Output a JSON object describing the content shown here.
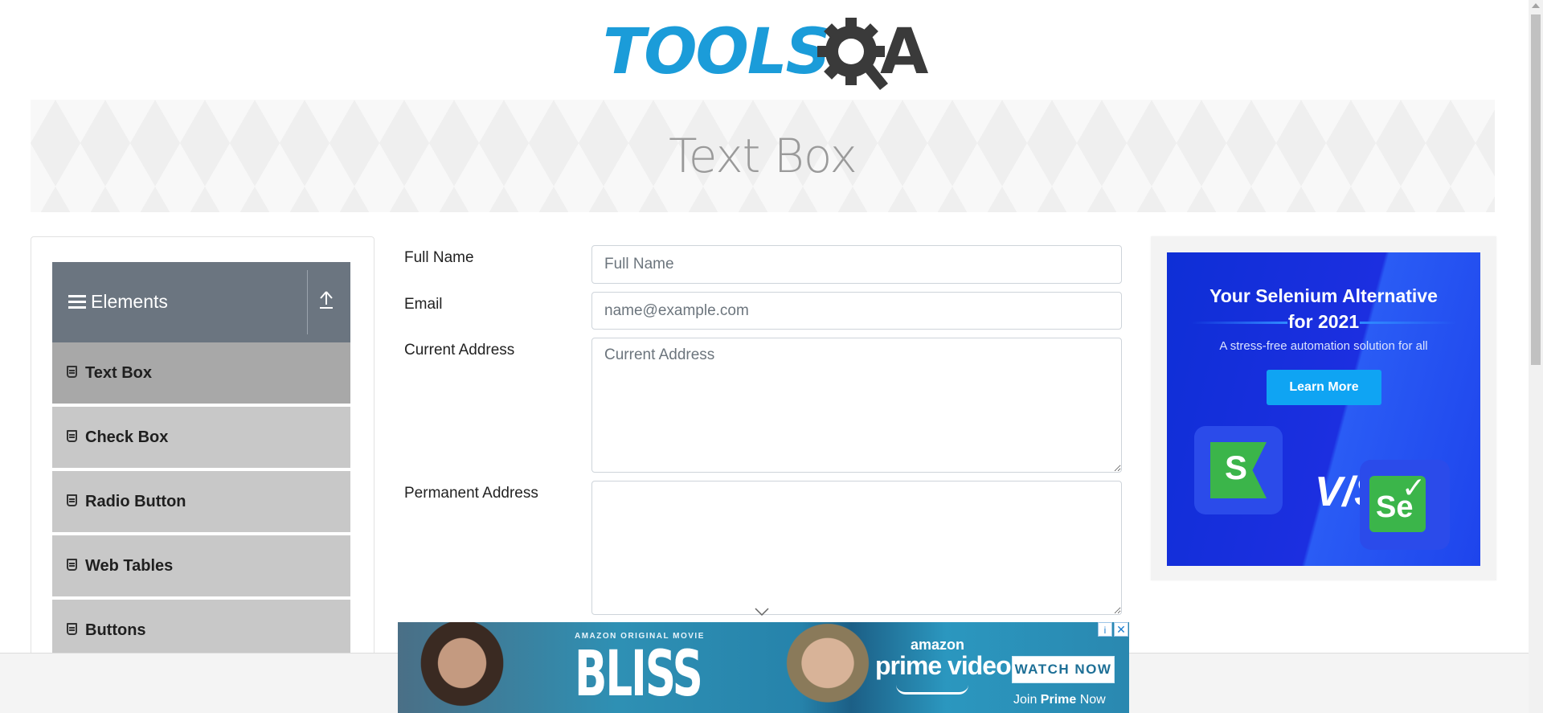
{
  "header": {
    "logo_text": "TOOLS",
    "logo_q": "Q",
    "logo_a": "A",
    "brand_colors": {
      "tools": "#1b9cd9",
      "qa": "#3a3a3a"
    }
  },
  "banner": {
    "title": "Text Box"
  },
  "sidebar": {
    "group_title": "Elements",
    "items": [
      {
        "label": "Text Box",
        "active": true
      },
      {
        "label": "Check Box"
      },
      {
        "label": "Radio Button"
      },
      {
        "label": "Web Tables"
      },
      {
        "label": "Buttons"
      }
    ]
  },
  "form": {
    "full_name": {
      "label": "Full Name",
      "placeholder": "Full Name",
      "value": ""
    },
    "email": {
      "label": "Email",
      "placeholder": "name@example.com",
      "value": ""
    },
    "current_address": {
      "label": "Current Address",
      "placeholder": "Current Address",
      "value": ""
    },
    "permanent_address": {
      "label": "Permanent Address",
      "placeholder": "",
      "value": ""
    }
  },
  "ad_right": {
    "headline_1": "Your Selenium Alternative",
    "headline_2": "for 2021",
    "subtext": "A stress-free automation solution for all",
    "button_label": "Learn More",
    "logo_left": "S",
    "vs_text": "V/S",
    "logo_right": "Se"
  },
  "bottom_ad": {
    "kicker": "AMAZON ORIGINAL MOVIE",
    "title": "BLISS",
    "brand_top": "amazon",
    "brand_main": "prime video",
    "cta": "WATCH NOW",
    "join_prefix": "Join ",
    "join_bold": "Prime",
    "join_suffix": " Now"
  }
}
